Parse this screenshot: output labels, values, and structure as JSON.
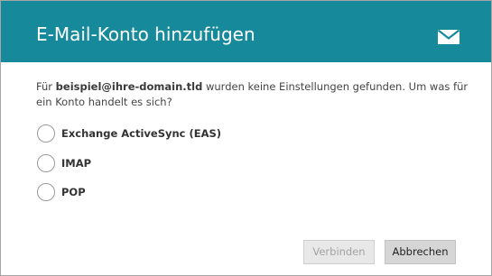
{
  "dialog": {
    "title": "E-Mail-Konto hinzufügen",
    "header_color": "#168a9a",
    "header_icon": "mail-icon",
    "message": {
      "prefix": "Für ",
      "email": "beispiel@ihre-domain.tld",
      "suffix": " wurden keine Einstellungen gefunden. Um was für ein Konto handelt es sich?"
    },
    "options": [
      {
        "label": "Exchange ActiveSync (EAS)",
        "selected": false
      },
      {
        "label": "IMAP",
        "selected": false
      },
      {
        "label": "POP",
        "selected": false
      }
    ],
    "buttons": {
      "connect": {
        "label": "Verbinden",
        "enabled": false
      },
      "cancel": {
        "label": "Abbrechen",
        "enabled": true
      }
    }
  }
}
